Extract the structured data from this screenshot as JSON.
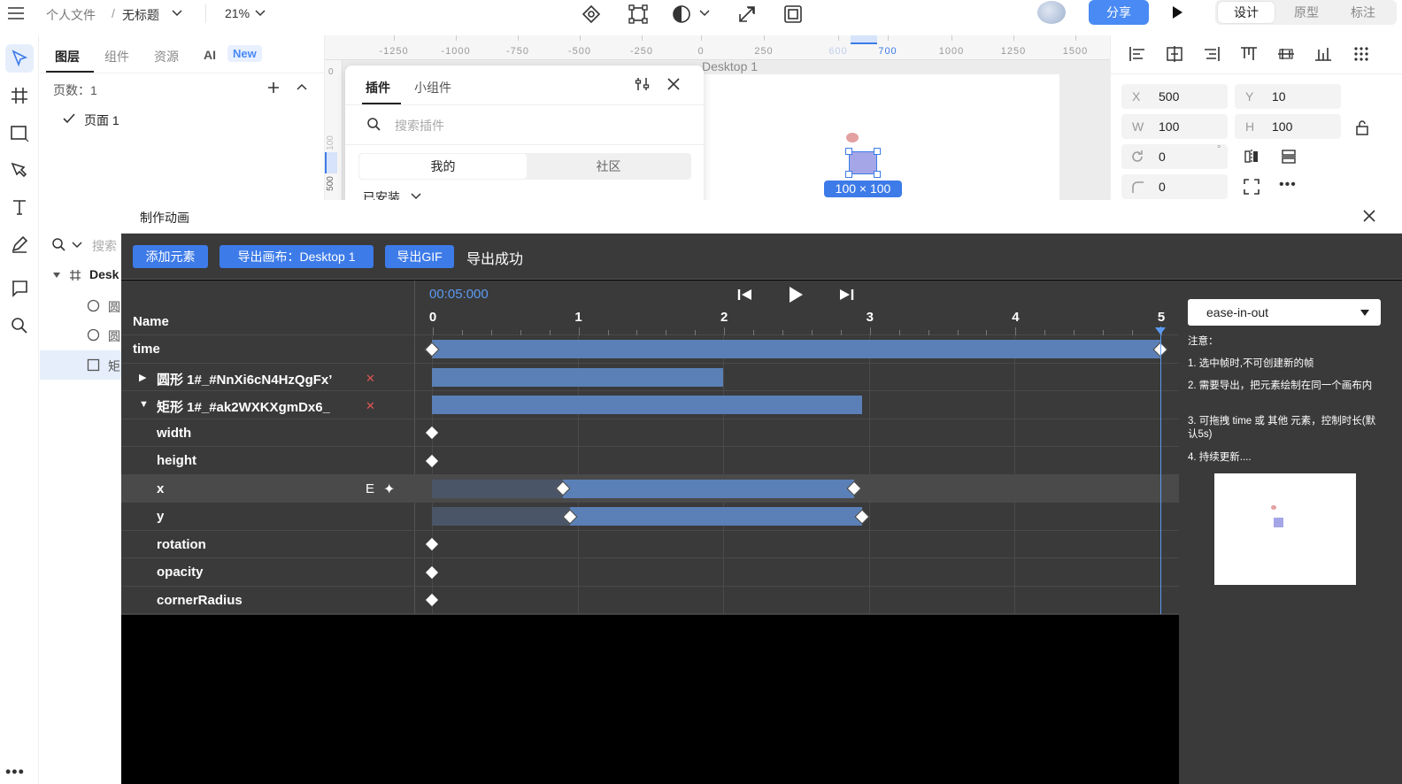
{
  "topbar": {
    "breadcrumb_root": "个人文件",
    "separator": "/",
    "doc_title": "无标题",
    "zoom": "21%",
    "share_label": "分享",
    "modes": [
      "设计",
      "原型",
      "标注"
    ]
  },
  "layers_panel": {
    "tabs": [
      "图层",
      "组件",
      "资源",
      "AI"
    ],
    "new_badge": "New",
    "pages_count_label": "页数：1",
    "page_item": "页面 1",
    "search_placeholder": "搜索",
    "tree": [
      {
        "label": "Desk",
        "icon": "frame-icon"
      },
      {
        "label": "圆",
        "icon": "ellipse-icon"
      },
      {
        "label": "圆",
        "icon": "ellipse-icon"
      },
      {
        "label": "矩",
        "icon": "rect-icon"
      }
    ]
  },
  "canvas": {
    "ruler_labels": [
      "-1250",
      "-1000",
      "-750",
      "-500",
      "-250",
      "0",
      "250",
      "600",
      "700",
      "1000",
      "1250",
      "1500"
    ],
    "left_ruler_labels": [
      "0",
      "100",
      "500"
    ],
    "frame_label": "Desktop 1",
    "selection_size": "100 × 100"
  },
  "plugin_panel": {
    "tabs": [
      "插件",
      "小组件"
    ],
    "search_placeholder": "搜索插件",
    "segments": [
      "我的",
      "社区"
    ],
    "installed_label": "已安装"
  },
  "properties": {
    "x_label": "X",
    "x_value": "500",
    "y_label": "Y",
    "y_value": "10",
    "w_label": "W",
    "w_value": "100",
    "h_label": "H",
    "h_value": "100",
    "rotation_value": "0",
    "rotation_unit": "°",
    "radius_value": "0"
  },
  "animation": {
    "title": "制作动画",
    "buttons": {
      "add_element": "添加元素",
      "export_canvas": "导出画布：Desktop 1",
      "export_gif": "导出GIF"
    },
    "status": "导出成功",
    "timecode": "00:05:000",
    "name_header": "Name",
    "ticks": [
      "0",
      "1",
      "2",
      "3",
      "4",
      "5"
    ],
    "duration_s": 5,
    "rows": [
      {
        "name": "time",
        "indent": 0,
        "bar": [
          0,
          5
        ],
        "keyframes": [
          0,
          5
        ]
      },
      {
        "name": "圆形 1#_#NnXi6cN4HzQgFx’",
        "indent": 1,
        "expander": "▶",
        "removable": true,
        "bar": [
          0,
          2
        ]
      },
      {
        "name": "矩形 1#_#ak2WXKXgmDx6_",
        "indent": 1,
        "expander": "▼",
        "removable": true,
        "bar": [
          0,
          2.95
        ]
      },
      {
        "name": "width",
        "indent": 2,
        "keyframes": [
          0
        ]
      },
      {
        "name": "height",
        "indent": 2,
        "keyframes": [
          0
        ]
      },
      {
        "name": "x",
        "indent": 2,
        "highlight": true,
        "edit_label": "E",
        "dim": [
          0,
          0.9
        ],
        "bar": [
          0.9,
          2.9
        ],
        "keyframes": [
          0.9,
          2.9
        ]
      },
      {
        "name": "y",
        "indent": 2,
        "dim": [
          0,
          0.95
        ],
        "bar": [
          0.95,
          2.95
        ],
        "keyframes": [
          0.95,
          2.95
        ]
      },
      {
        "name": "rotation",
        "indent": 2,
        "keyframes": [
          0
        ]
      },
      {
        "name": "opacity",
        "indent": 2,
        "keyframes": [
          0
        ]
      },
      {
        "name": "cornerRadius",
        "indent": 2,
        "keyframes": [
          0
        ]
      }
    ],
    "easing": "ease-in-out",
    "notes_title": "注意：",
    "notes": [
      "1. 选中帧时,不可创建新的帧",
      "2. 需要导出，把元素绘制在同一个画布内",
      "3. 可拖拽 time 或 其他 元素，控制时长(默认5s)",
      "4. 持续更新...."
    ]
  },
  "colors": {
    "accent": "#4a8af4",
    "timeline_bar": "#5a80b7",
    "dialog_bg": "#3a3a3a"
  }
}
